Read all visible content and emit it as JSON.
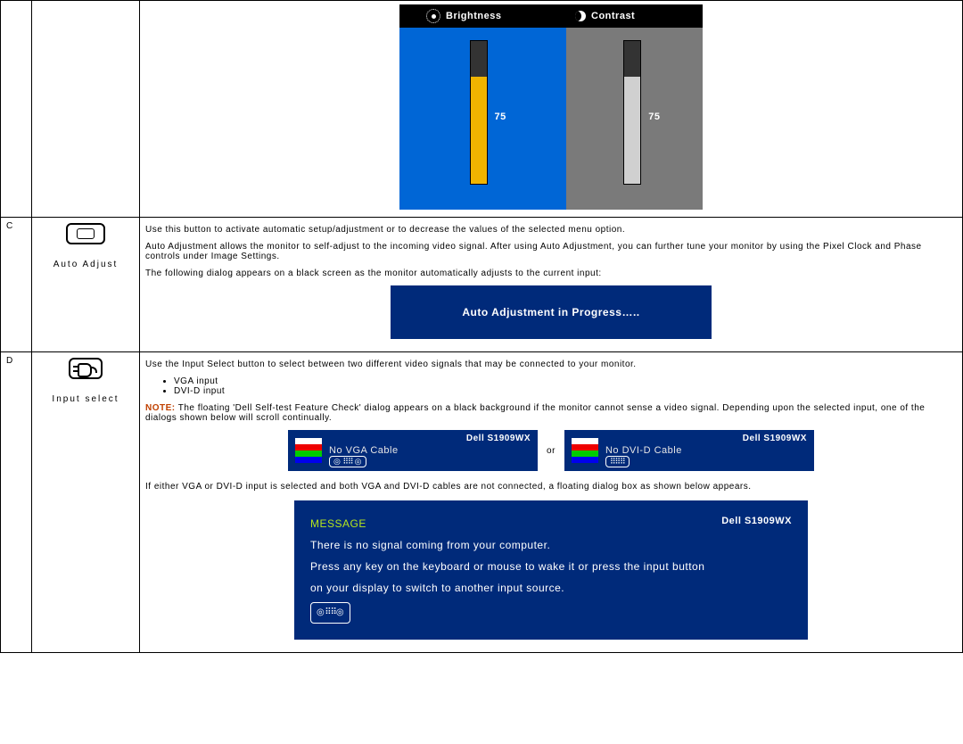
{
  "brightness_contrast": {
    "brightness_label": "Brightness",
    "contrast_label": "Contrast",
    "brightness_value": "75",
    "contrast_value": "75",
    "brightness_pct": 75,
    "contrast_pct": 75
  },
  "row_c": {
    "letter": "C",
    "label": "Auto Adjust",
    "p1": "Use this button to activate automatic setup/adjustment or to decrease the values of the selected menu option.",
    "p2": "Auto Adjustment allows the monitor to self-adjust to the incoming video signal. After using Auto Adjustment, you can further tune your monitor by using the Pixel Clock and Phase controls under Image Settings.",
    "p3": "The following dialog appears on a black screen as the monitor automatically adjusts to the current input:",
    "dialog": "Auto Adjustment in Progress….."
  },
  "row_d": {
    "letter": "D",
    "label": "Input select",
    "p1": "Use the Input Select button to select between two different video signals that may be connected to your monitor.",
    "inputs": [
      "VGA input",
      "DVI-D input"
    ],
    "note_label": "NOTE:",
    "note_text": " The floating 'Dell Self-test Feature Check' dialog appears on a black background if the monitor cannot sense a video signal. Depending upon the selected input, one of the dialogs shown below will scroll continually.",
    "cable1": {
      "brand": "Dell S1909WX",
      "text": "No VGA Cable"
    },
    "or": "or",
    "cable2": {
      "brand": "Dell S1909WX",
      "text": "No DVI-D Cable"
    },
    "p_after": "If either VGA or DVI-D input is selected and both VGA and DVI-D cables are not connected, a floating dialog box as shown below appears.",
    "msg": {
      "head": "MESSAGE",
      "brand": "Dell S1909WX",
      "l1": "There is no signal coming from your computer.",
      "l2": "Press any key on the keyboard or mouse to wake it or press the input button",
      "l3": "on your display to switch to another input source."
    }
  }
}
